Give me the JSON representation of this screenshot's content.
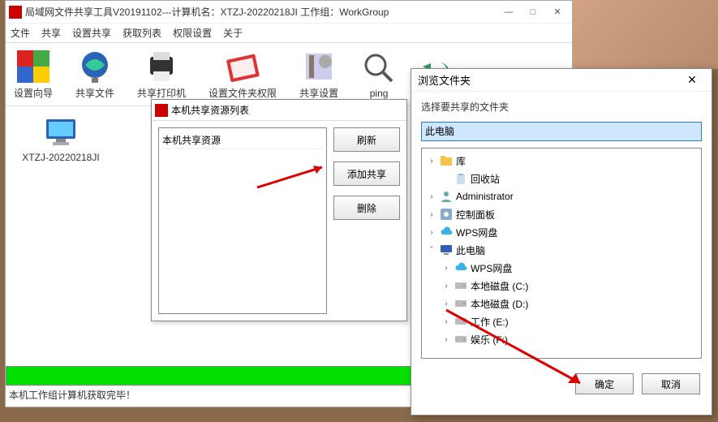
{
  "main": {
    "title": "局域网文件共享工具V20191102---计算机名：XTZJ-20220218JI  工作组：WorkGroup",
    "menus": [
      "文件",
      "共享",
      "设置共享",
      "获取列表",
      "权限设置",
      "关于"
    ],
    "toolbar": [
      {
        "label": "设置向导",
        "name": "wizard-icon"
      },
      {
        "label": "共享文件",
        "name": "share-file-icon"
      },
      {
        "label": "共享打印机",
        "name": "printer-icon"
      },
      {
        "label": "设置文件夹权限",
        "name": "folder-perm-icon"
      },
      {
        "label": "共享设置",
        "name": "share-settings-icon"
      },
      {
        "label": "ping",
        "name": "ping-icon"
      }
    ],
    "desktop_item": "XTZJ-20220218JI",
    "status": "本机工作组计算机获取完毕！"
  },
  "share_dialog": {
    "title": "本机共享资源列表",
    "list_item": "本机共享资源",
    "buttons": {
      "refresh": "刷新",
      "add": "添加共享",
      "delete": "删除"
    }
  },
  "browse_dialog": {
    "title": "浏览文件夹",
    "subtitle": "选择要共享的文件夹",
    "selected": "此电脑",
    "tree": [
      {
        "indent": 0,
        "exp": "›",
        "label": "库",
        "icon": "folder-yellow"
      },
      {
        "indent": 1,
        "exp": "",
        "label": "回收站",
        "icon": "recycle"
      },
      {
        "indent": 0,
        "exp": "›",
        "label": "Administrator",
        "icon": "user"
      },
      {
        "indent": 0,
        "exp": "›",
        "label": "控制面板",
        "icon": "control"
      },
      {
        "indent": 0,
        "exp": "›",
        "label": "WPS网盘",
        "icon": "cloud"
      },
      {
        "indent": 0,
        "exp": "ˇ",
        "label": "此电脑",
        "icon": "pc"
      },
      {
        "indent": 1,
        "exp": "›",
        "label": "WPS网盘",
        "icon": "cloud"
      },
      {
        "indent": 1,
        "exp": "›",
        "label": "本地磁盘 (C:)",
        "icon": "disk"
      },
      {
        "indent": 1,
        "exp": "›",
        "label": "本地磁盘 (D:)",
        "icon": "disk"
      },
      {
        "indent": 1,
        "exp": "›",
        "label": "工作 (E:)",
        "icon": "disk"
      },
      {
        "indent": 1,
        "exp": "›",
        "label": "娱乐 (F:)",
        "icon": "disk"
      }
    ],
    "buttons": {
      "ok": "确定",
      "cancel": "取消"
    }
  }
}
